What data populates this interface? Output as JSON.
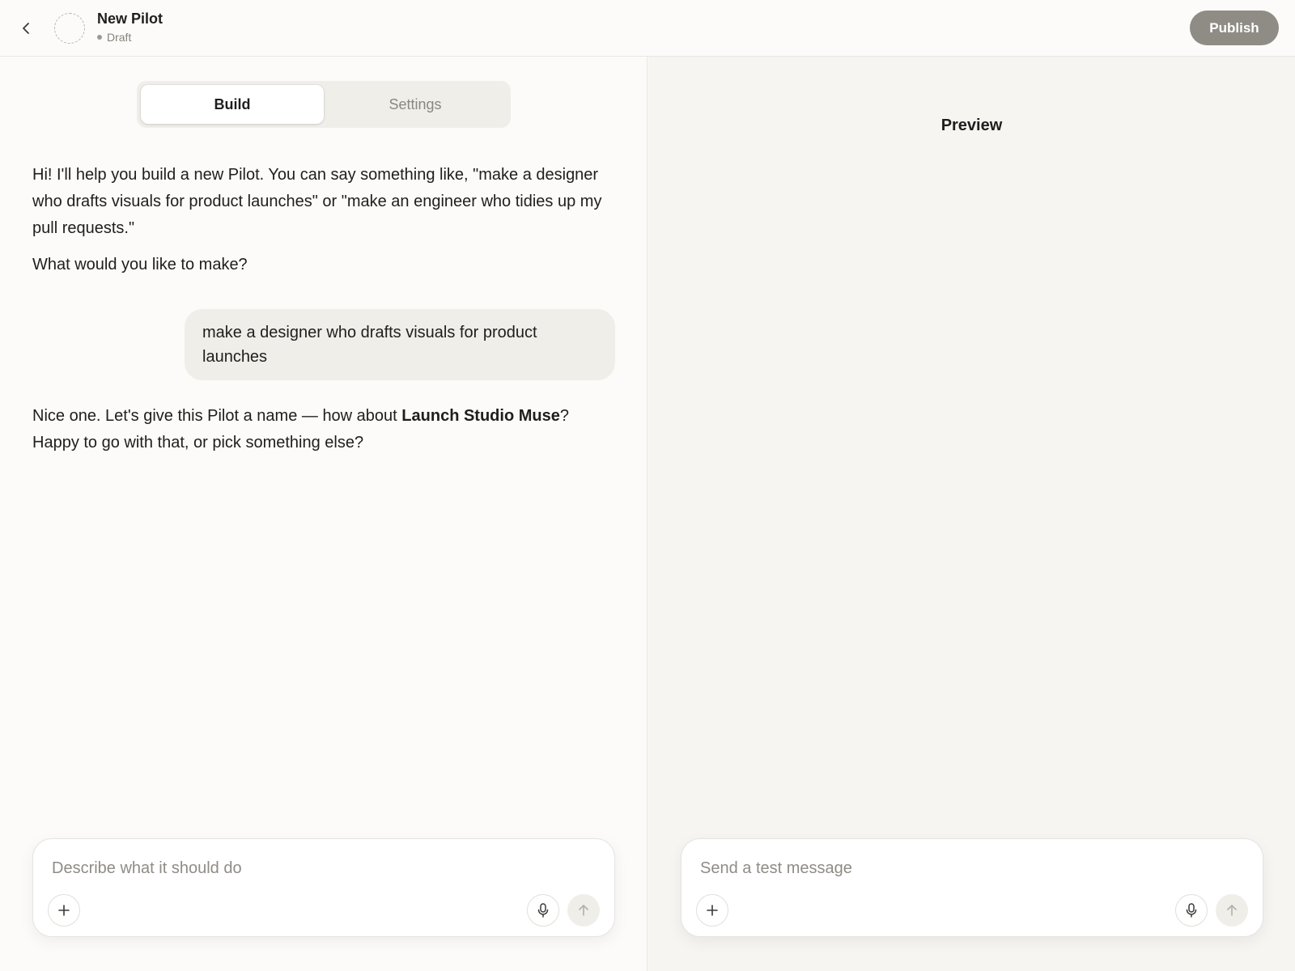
{
  "header": {
    "title": "New Pilot",
    "status": "Draft",
    "publish_label": "Publish",
    "back_icon": "chevron-left-icon"
  },
  "tabs": [
    {
      "label": "Build",
      "active": true
    },
    {
      "label": "Settings",
      "active": false
    }
  ],
  "conversation": {
    "bot_intro_1": "Hi! I'll help you build a new Pilot. You can say something like, \"make a designer who drafts visuals for product launches\" or \"make an engineer who tidies up my pull requests.\"",
    "bot_intro_2": "What would you like to make?",
    "user_message": "make a designer who drafts visuals for product launches",
    "bot_reply_before": "Nice one. Let's give this Pilot a name — how about ",
    "bot_reply_name": "Launch Studio Muse",
    "bot_reply_after": "? Happy to go with that, or pick something else?"
  },
  "build_composer": {
    "placeholder": "Describe what it should do",
    "value": ""
  },
  "preview": {
    "title": "Preview",
    "composer_placeholder": "Send a test message",
    "composer_value": ""
  },
  "icons": {
    "attach": "plus-icon",
    "voice": "microphone-icon",
    "send": "arrow-up-icon"
  },
  "colors": {
    "publish_disabled": "#8f8c86",
    "background": "#fcfbf9",
    "preview_background": "#f6f5f2",
    "bubble": "#f0eee9"
  }
}
